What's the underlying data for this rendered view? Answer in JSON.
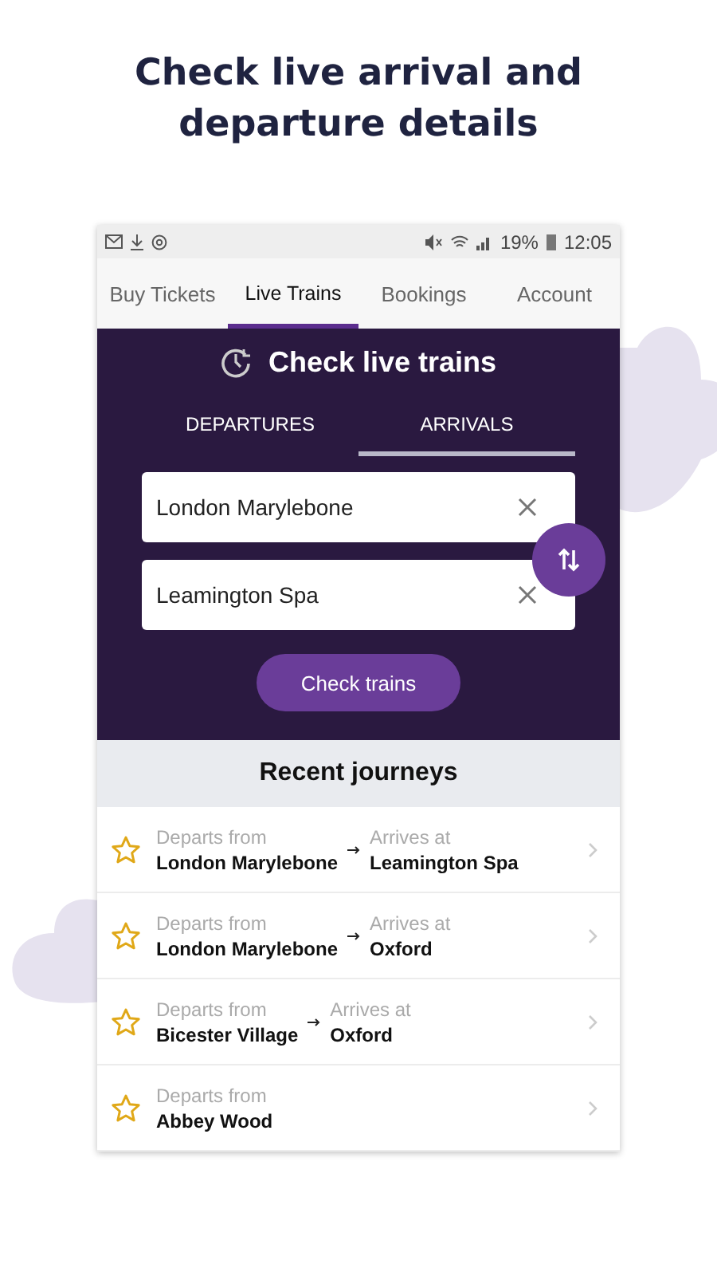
{
  "headline": "Check live arrival and departure details",
  "status_bar": {
    "battery": "19%",
    "time": "12:05"
  },
  "tabs": [
    {
      "label": "Buy Tickets",
      "selected": false
    },
    {
      "label": "Live Trains",
      "selected": true
    },
    {
      "label": "Bookings",
      "selected": false
    },
    {
      "label": "Account",
      "selected": false
    }
  ],
  "panel": {
    "title": "Check live trains",
    "modes": [
      {
        "label": "DEPARTURES",
        "selected": false
      },
      {
        "label": "ARRIVALS",
        "selected": true
      }
    ],
    "from": {
      "value": "London Marylebone"
    },
    "to": {
      "value": "Leamington Spa"
    },
    "button": "Check trains"
  },
  "recent": {
    "title": "Recent journeys",
    "journeys": [
      {
        "departs_label": "Departs from",
        "departs": "London Marylebone",
        "arrives_label": "Arrives at",
        "arrives": "Leamington Spa"
      },
      {
        "departs_label": "Departs from",
        "departs": "London Marylebone",
        "arrives_label": "Arrives at",
        "arrives": "Oxford"
      },
      {
        "departs_label": "Departs from",
        "departs": "Bicester Village",
        "arrives_label": "Arrives at",
        "arrives": "Oxford"
      },
      {
        "departs_label": "Departs from",
        "departs": "Abbey Wood"
      }
    ]
  }
}
